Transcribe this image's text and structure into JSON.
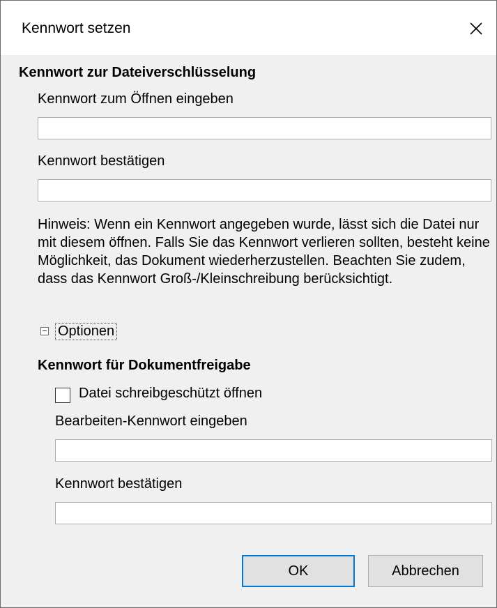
{
  "dialog": {
    "title": "Kennwort setzen",
    "close_icon": "close-icon"
  },
  "encryption": {
    "heading": "Kennwort zur Dateiverschlüsselung",
    "open_password_label": "Kennwort zum Öffnen eingeben",
    "open_password_value": "",
    "confirm_label": "Kennwort bestätigen",
    "confirm_value": "",
    "note": "Hinweis: Wenn ein Kennwort angegeben wurde, lässt sich die Datei nur mit diesem öffnen. Falls Sie das Kennwort verlieren sollten, besteht keine Möglichkeit, das Dokument wiederherzustellen. Beachten Sie zudem, dass das Kennwort Groß-/Kleinschreibung berücksichtigt."
  },
  "options": {
    "label": "Optionen",
    "expander_icon": "collapse-minus-icon"
  },
  "sharing": {
    "heading": "Kennwort für Dokumentfreigabe",
    "readonly_label": "Datei schreibgeschützt öffnen",
    "readonly_checked": false,
    "edit_password_label": "Bearbeiten-Kennwort eingeben",
    "edit_password_value": "",
    "confirm_label": "Kennwort bestätigen",
    "confirm_value": ""
  },
  "buttons": {
    "ok": "OK",
    "cancel": "Abbrechen"
  }
}
